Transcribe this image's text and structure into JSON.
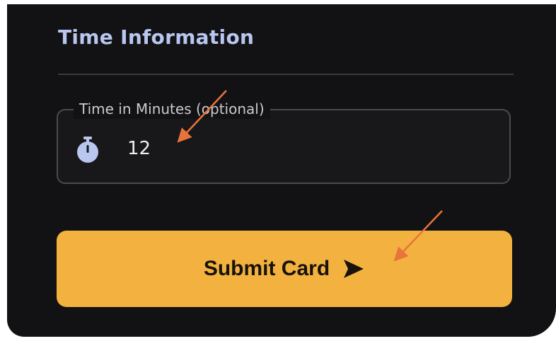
{
  "section": {
    "title": "Time Information"
  },
  "time_field": {
    "label": "Time in Minutes (optional)",
    "value": "12",
    "icon": "stopwatch-icon"
  },
  "submit_button": {
    "label": "Submit Card",
    "icon": "send-icon"
  },
  "colors": {
    "background": "#121214",
    "title": "#b9c6ef",
    "accent": "#f3b23f",
    "annotation_arrow": "#e8743b"
  }
}
